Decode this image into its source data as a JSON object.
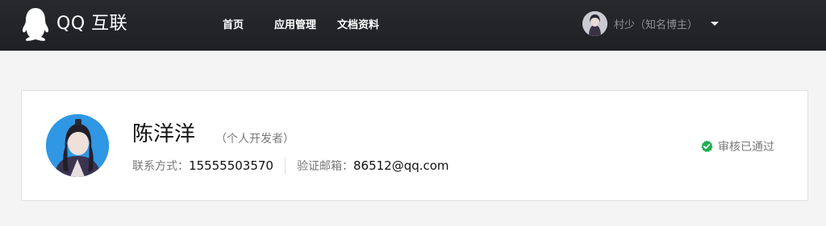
{
  "header": {
    "logo_text": "QQ 互联",
    "nav": [
      {
        "label": "首页"
      },
      {
        "label": "应用管理"
      },
      {
        "label": "文档资料"
      }
    ],
    "user": {
      "name": "村少（知名博主）"
    }
  },
  "developer": {
    "name": "陈洋洋",
    "type": "（个人开发者）",
    "contact_label": "联系方式：",
    "contact_value": "15555503570",
    "email_label": "验证邮箱：",
    "email_value": "86512@qq.com",
    "status": "审核已通过"
  },
  "colors": {
    "header_bg": "#1e2024",
    "status_green": "#1fad52",
    "avatar_bg": "#2f97e4"
  },
  "icons": [
    "qq-penguin-icon",
    "user-avatar-icon",
    "caret-down-icon",
    "developer-avatar-icon",
    "check-badge-icon"
  ]
}
